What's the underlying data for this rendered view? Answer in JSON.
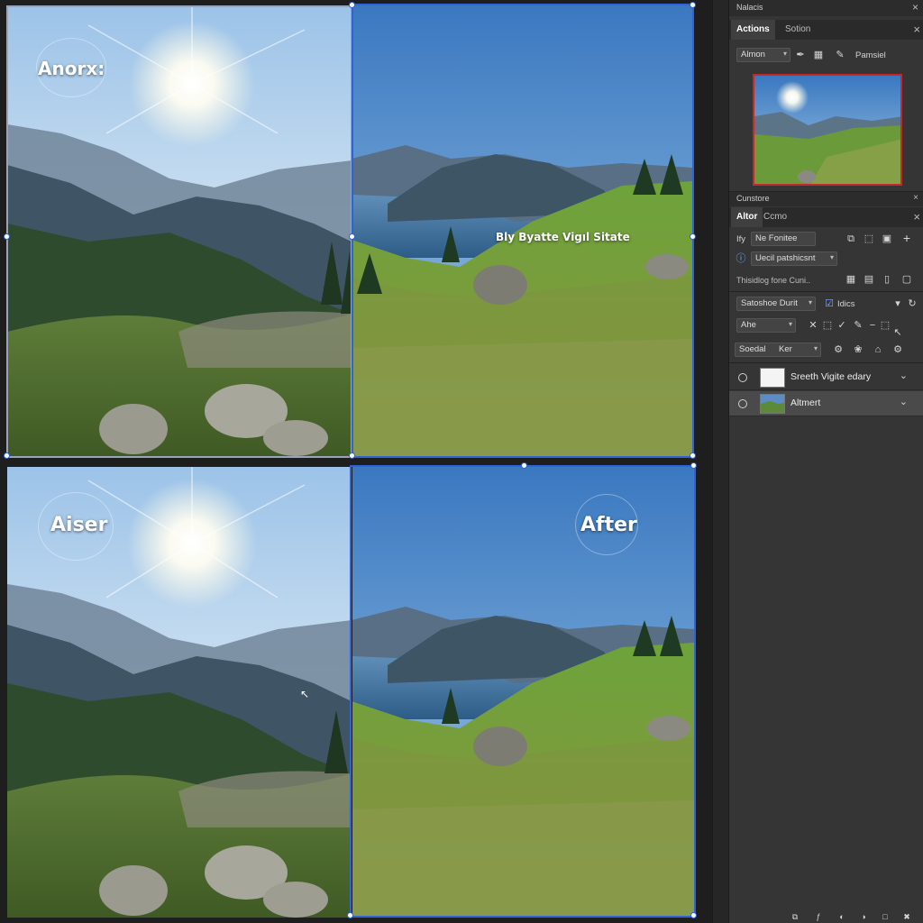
{
  "canvas": {
    "top_left_label": "Anorx:",
    "top_right_caption": "Bly Byatte Vigıl Sitate",
    "bottom_left_label": "Aiser",
    "bottom_right_label": "After"
  },
  "panel": {
    "header_title": "Nalacis",
    "tabs": [
      "Actions",
      "Sotion"
    ],
    "toolbar1": {
      "dropdown": "Almon",
      "label": "Pamsiel"
    },
    "section_title": "Cunstore",
    "tabs2": [
      "Altor",
      "Ccmo"
    ],
    "row_a": {
      "prefix": "Ify",
      "field": "Ne Fonitee"
    },
    "row_b": {
      "field": "Uecil patshicsnt"
    },
    "info_text": "Thisidlog fone Cuni..",
    "row_c": {
      "dropdown": "Satoshoe Durit",
      "checkbox_label": "Idics"
    },
    "row_d": {
      "dropdown": "Ahe"
    },
    "row_e": {
      "dropdown": "Soedal",
      "dropdown_value": "Ker"
    },
    "layers": [
      {
        "name": "Sreeth Vigite edary",
        "selected": false
      },
      {
        "name": "Altmert",
        "selected": true
      }
    ]
  },
  "colors": {
    "accent": "#2f63d6",
    "thumb_border": "#c62828",
    "panel_bg": "#353535"
  }
}
